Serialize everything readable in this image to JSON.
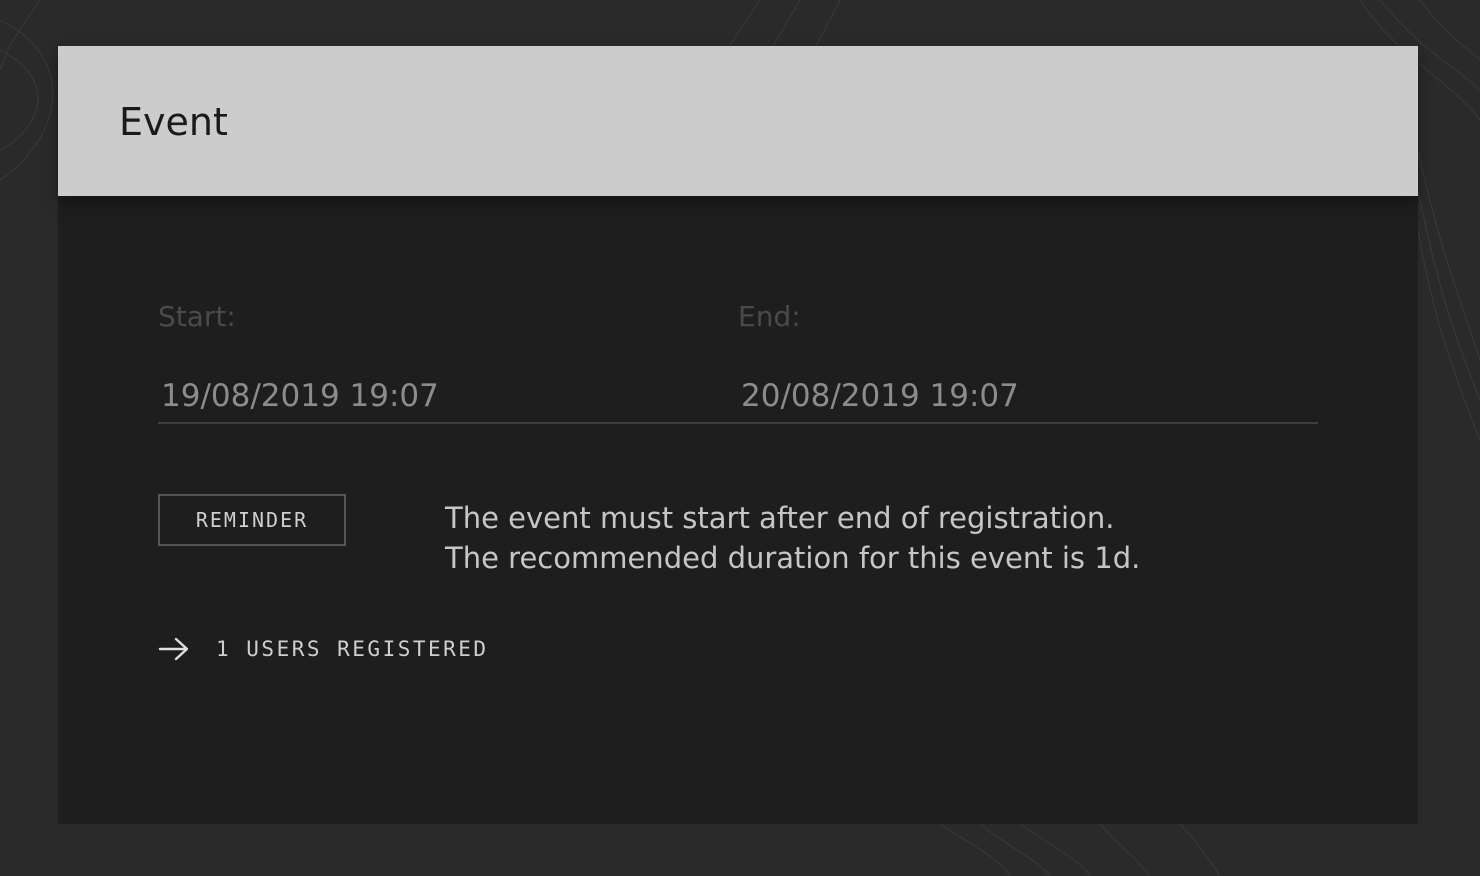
{
  "card": {
    "title": "Event",
    "start": {
      "label": "Start:",
      "value": "19/08/2019 19:07"
    },
    "end": {
      "label": "End:",
      "value": "20/08/2019 19:07"
    },
    "reminder": {
      "badge": "REMINDER",
      "lines": [
        "The event must start after end of registration.",
        "The recommended duration for this event is 1d."
      ]
    },
    "users_link": {
      "icon": "arrow-right-icon",
      "label": "1 USERS REGISTERED"
    }
  },
  "colors": {
    "page_bg": "#2a2a2a",
    "card_bg": "#1e1e1e",
    "header_bg": "#cccccc"
  }
}
